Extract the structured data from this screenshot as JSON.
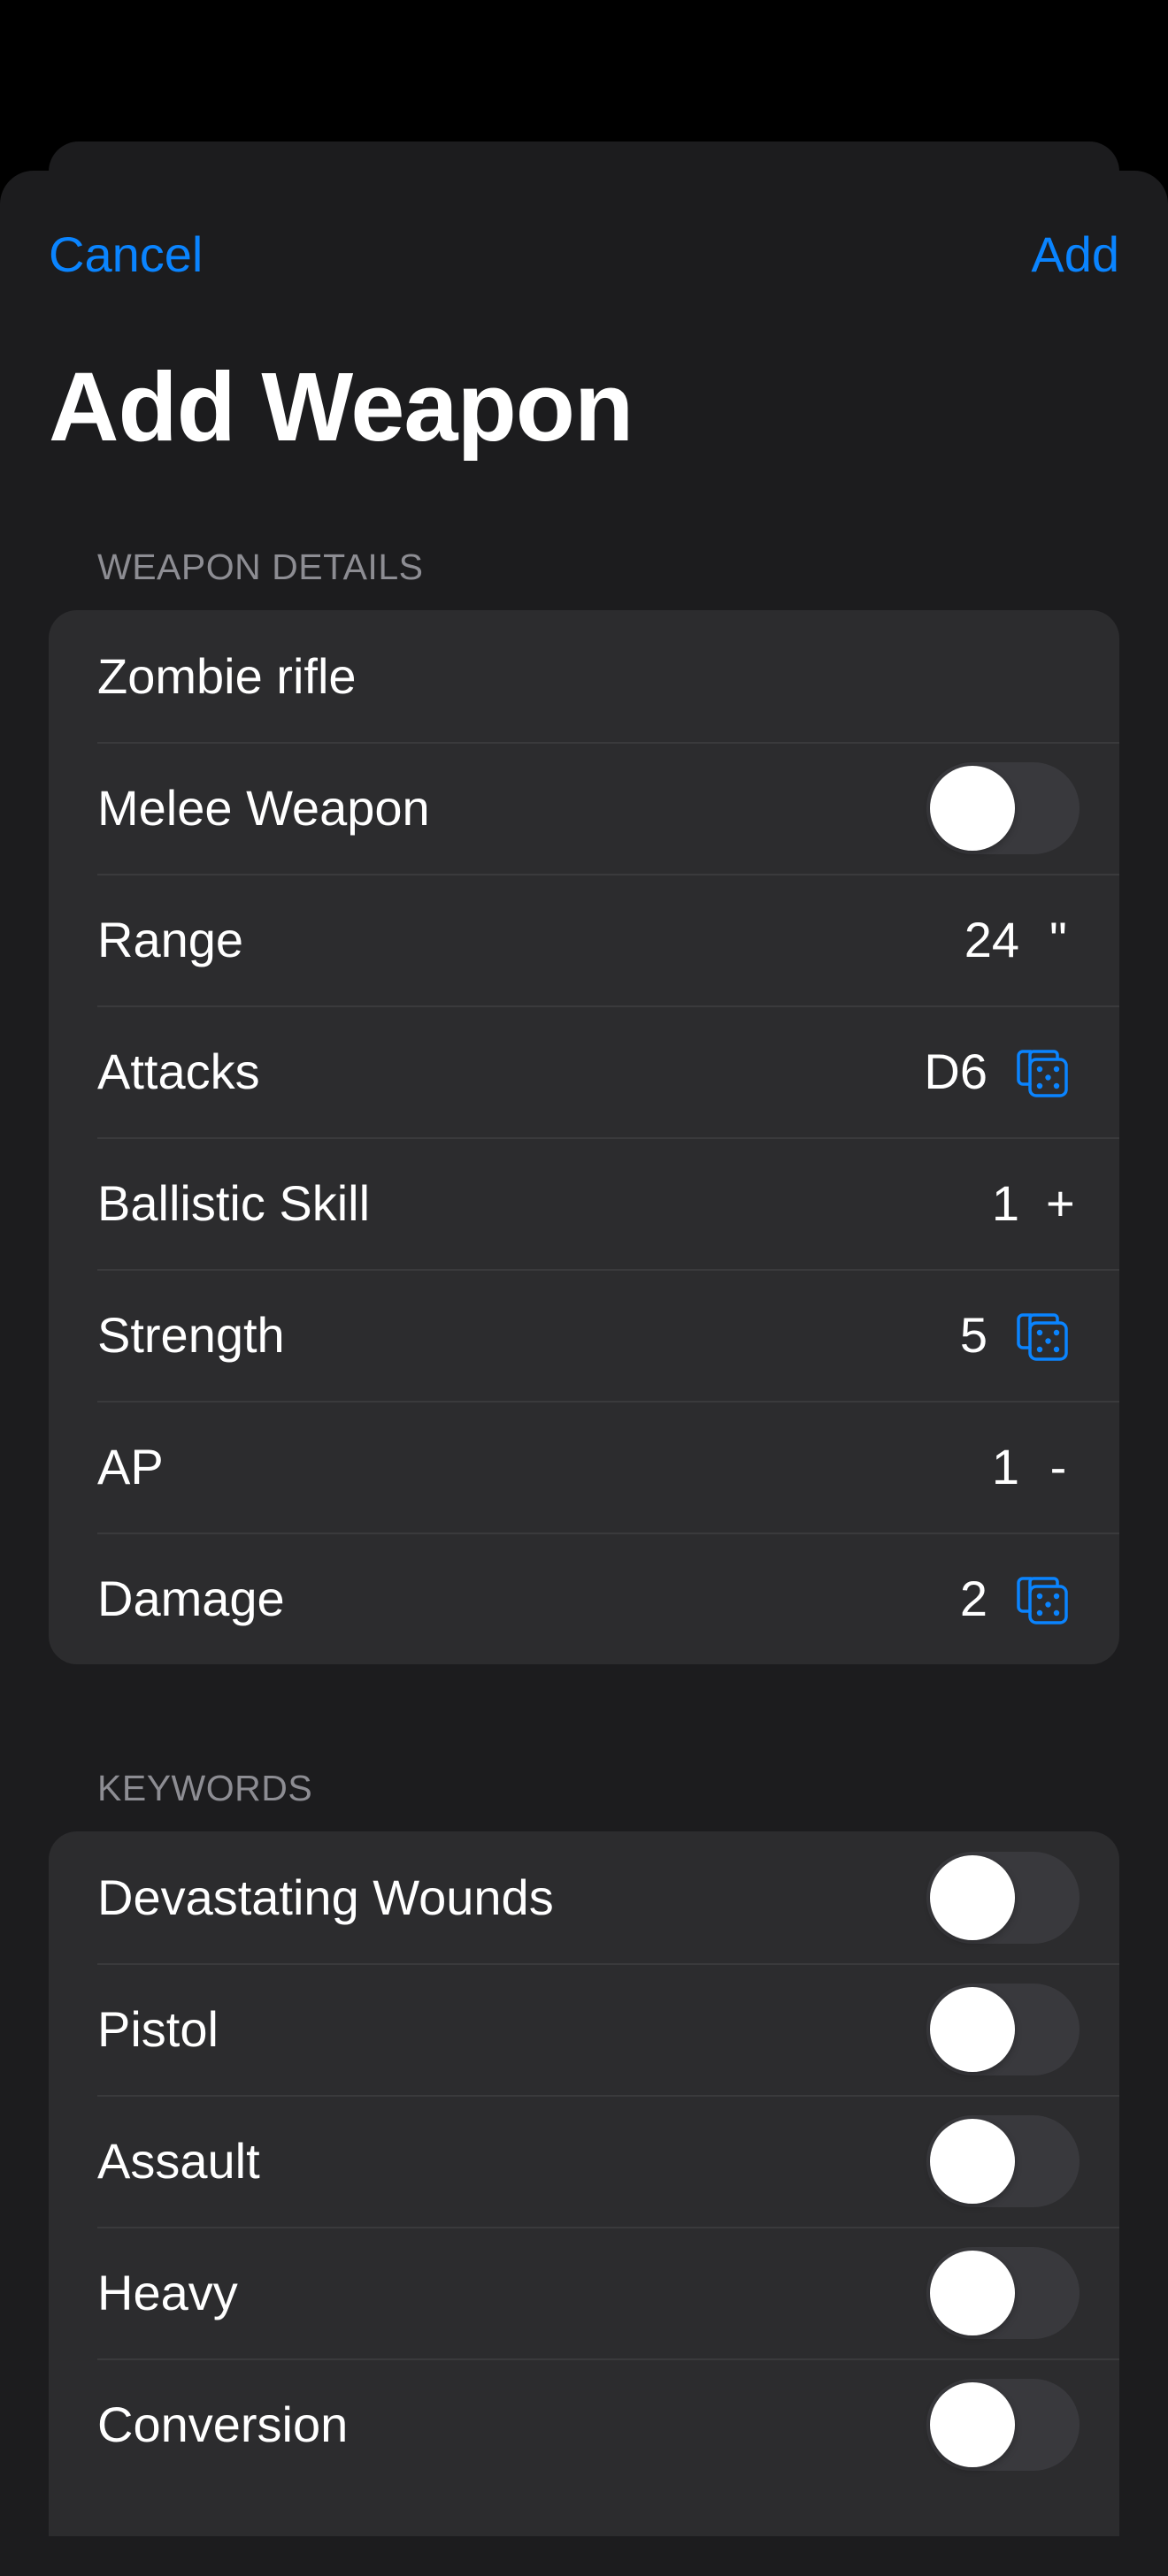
{
  "nav": {
    "cancel_label": "Cancel",
    "add_label": "Add",
    "title": "Add Weapon"
  },
  "weapon_details": {
    "header": "WEAPON DETAILS",
    "name_value": "Zombie rifle",
    "melee": {
      "label": "Melee Weapon",
      "on": false
    },
    "range": {
      "label": "Range",
      "value": "24",
      "unit": "\""
    },
    "attacks": {
      "label": "Attacks",
      "value": "D6",
      "icon": "dice-icon"
    },
    "ballistic_skill": {
      "label": "Ballistic Skill",
      "value": "1",
      "unit": "+"
    },
    "strength": {
      "label": "Strength",
      "value": "5",
      "icon": "dice-icon"
    },
    "ap": {
      "label": "AP",
      "value": "1",
      "unit": "-"
    },
    "damage": {
      "label": "Damage",
      "value": "2",
      "icon": "dice-icon"
    }
  },
  "keywords": {
    "header": "KEYWORDS",
    "items": [
      {
        "label": "Devastating Wounds",
        "on": false
      },
      {
        "label": "Pistol",
        "on": false
      },
      {
        "label": "Assault",
        "on": false
      },
      {
        "label": "Heavy",
        "on": false
      },
      {
        "label": "Conversion",
        "on": false
      }
    ]
  },
  "colors": {
    "accent": "#0a84ff",
    "background": "#1c1c1e",
    "cell": "#2c2c2e",
    "toggle_off": "#39393d"
  }
}
